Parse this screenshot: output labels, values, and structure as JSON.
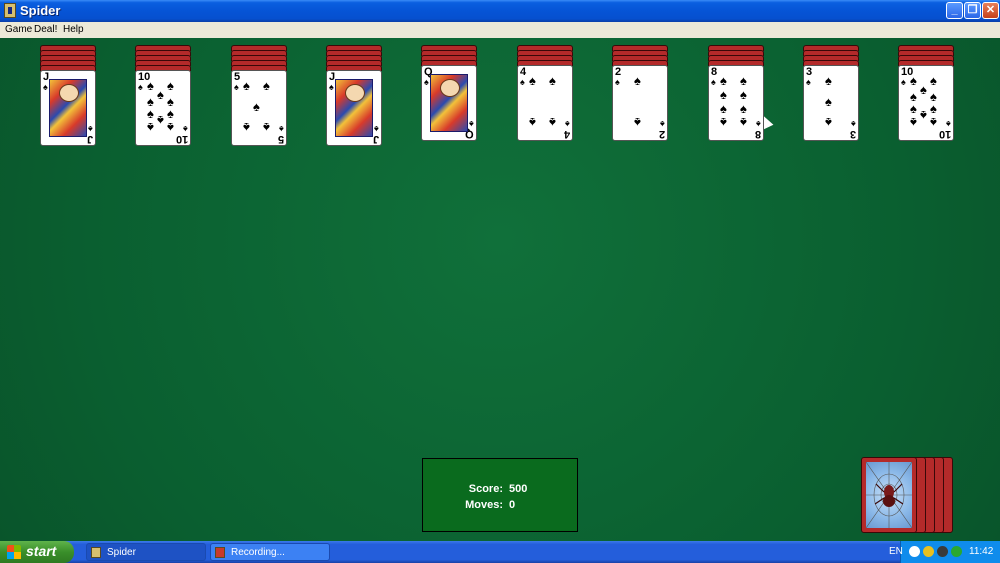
{
  "window": {
    "title": "Spider"
  },
  "menu": [
    {
      "label": "Game"
    },
    {
      "label": "Deal!"
    },
    {
      "label": "Help"
    }
  ],
  "columns": [
    {
      "rank": "J",
      "suit": "♠",
      "face": true
    },
    {
      "rank": "10",
      "suit": "♠",
      "face": false
    },
    {
      "rank": "5",
      "suit": "♠",
      "face": false
    },
    {
      "rank": "J",
      "suit": "♠",
      "face": true
    },
    {
      "rank": "Q",
      "suit": "♠",
      "face": true
    },
    {
      "rank": "4",
      "suit": "♠",
      "face": false
    },
    {
      "rank": "2",
      "suit": "♠",
      "face": false
    },
    {
      "rank": "8",
      "suit": "♠",
      "face": false
    },
    {
      "rank": "3",
      "suit": "♠",
      "face": false
    },
    {
      "rank": "10",
      "suit": "♠",
      "face": false
    }
  ],
  "score_panel": {
    "score_label": "Score:",
    "score": "500",
    "moves_label": "Moves:",
    "moves": "0"
  },
  "stock": {
    "piles_remaining": 5
  },
  "taskbar": {
    "start_label": "start",
    "tasks": [
      {
        "label": "Spider",
        "active": true
      },
      {
        "label": "Recording...",
        "active": false
      }
    ],
    "language": "EN",
    "clock": "11:42"
  },
  "colors": {
    "felt": "#0a5f30",
    "card_back": "#b42a2a",
    "score_box": "#0a6b1e"
  }
}
